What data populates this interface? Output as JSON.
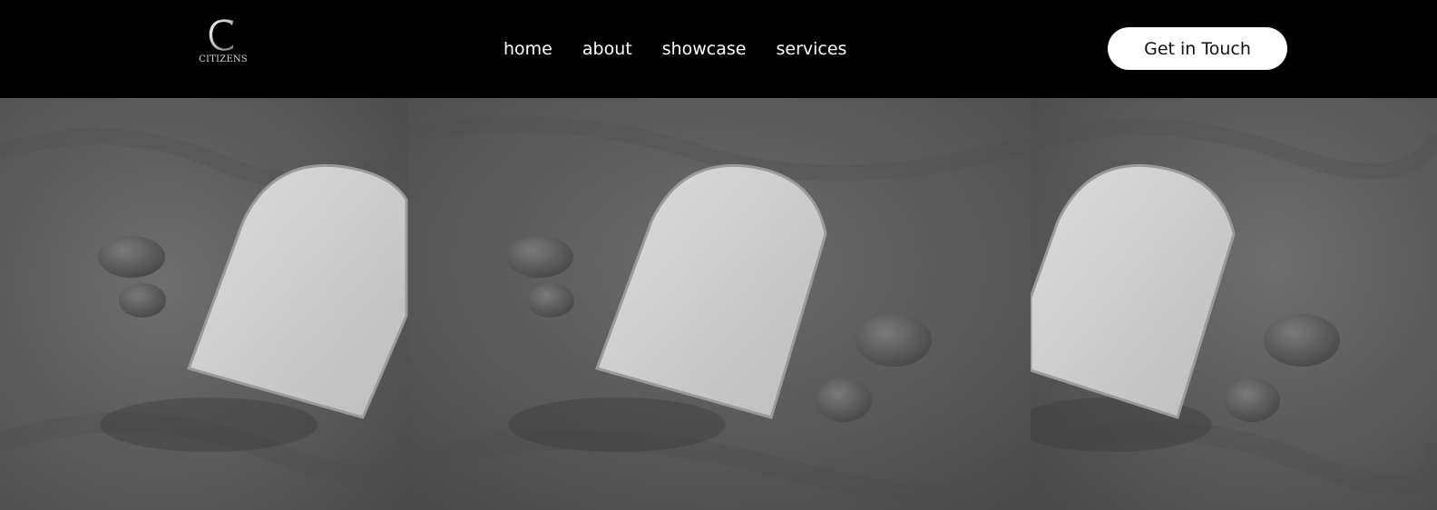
{
  "brand": {
    "logo_letter": "C",
    "name": "CITIZENS"
  },
  "nav": {
    "items": [
      {
        "label": "home"
      },
      {
        "label": "about"
      },
      {
        "label": "showcase"
      },
      {
        "label": "services"
      }
    ]
  },
  "cta": {
    "label": "Get in Touch"
  },
  "hero": {
    "image_subject": "arched mirrors and pebbles on grey sand",
    "panels": 3
  },
  "colors": {
    "header_bg": "#000000",
    "button_bg": "#ffffff",
    "sand": "#5a5a5a"
  }
}
